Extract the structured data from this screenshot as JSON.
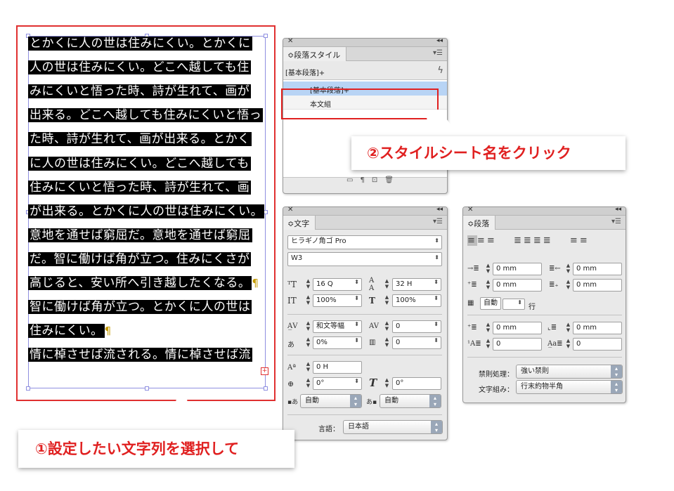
{
  "text_frame": {
    "lines": [
      {
        "text": "とかくに人の世は住みにくい。とかくに",
        "selected": true
      },
      {
        "text": "人の世は住みにくい。どこへ越しても住",
        "selected": true
      },
      {
        "text": "みにくいと悟った時、詩が生れて、画が",
        "selected": true
      },
      {
        "text": "出来る。どこへ越しても住みにくいと悟っ",
        "selected": true
      },
      {
        "text": "た時、詩が生れて、画が出来る。とかく",
        "selected": true
      },
      {
        "text": "に人の世は住みにくい。どこへ越しても",
        "selected": true
      },
      {
        "text": "住みにくいと悟った時、詩が生れて、画",
        "selected": true
      },
      {
        "text": "が出来る。とかくに人の世は住みにくい。",
        "selected": true
      },
      {
        "text": "意地を通せば窮屈だ。意地を通せば窮屈",
        "selected": true
      },
      {
        "text": "だ。智に働けば角が立つ。住みにくさが",
        "selected": true
      },
      {
        "text": "高じると、安い所へ引き越したくなる。",
        "selected": true,
        "pilcrow": "¶"
      },
      {
        "text": "智に働けば角が立つ。とかくに人の世は",
        "selected": true
      },
      {
        "text": "住みにくい。",
        "selected": true,
        "pilcrow": "¶"
      },
      {
        "text": "情に棹させば流される。情に棹させば流",
        "selected": true
      }
    ],
    "overset_symbol": "+"
  },
  "paragraph_styles_panel": {
    "tab": "段落スタイル",
    "current_style": "[基本段落]+",
    "items": [
      "[基本段落]+",
      "本文組"
    ],
    "bolt_icon": "lightning-icon"
  },
  "character_panel": {
    "tab": "文字",
    "font_family": "ヒラギノ角ゴ Pro",
    "font_style": "W3",
    "size": "16 Q",
    "leading": "32 H",
    "vertical_scale": "100%",
    "horizontal_scale": "100%",
    "kerning": "和文等幅",
    "tracking": "0",
    "tsume": "0%",
    "aki": "0",
    "baseline_shift": "0 H",
    "rotation": "0°",
    "skew": "0°",
    "aki_before": "自動",
    "aki_after": "自動",
    "language_label": "言語：",
    "language": "日本語"
  },
  "paragraph_panel": {
    "tab": "段落",
    "left_indent": "0 mm",
    "right_indent": "0 mm",
    "first_line_indent": "0 mm",
    "last_line_right_indent": "0 mm",
    "grid_lines": "自動",
    "grid_unit": "行",
    "space_before": "0 mm",
    "space_after": "0 mm",
    "drop_cap_lines": "0",
    "drop_cap_chars": "0",
    "kinsoku_label": "禁則処理：",
    "kinsoku_value": "強い禁則",
    "mojikumi_label": "文字組み：",
    "mojikumi_value": "行末約物半角"
  },
  "callouts": {
    "step1": "①設定したい文字列を選択して",
    "step2": "②スタイルシート名をクリック"
  },
  "colors": {
    "accent_red": "#e02020",
    "selection_blue": "#b8d4f5",
    "frame_blue": "#8f8fe0"
  }
}
